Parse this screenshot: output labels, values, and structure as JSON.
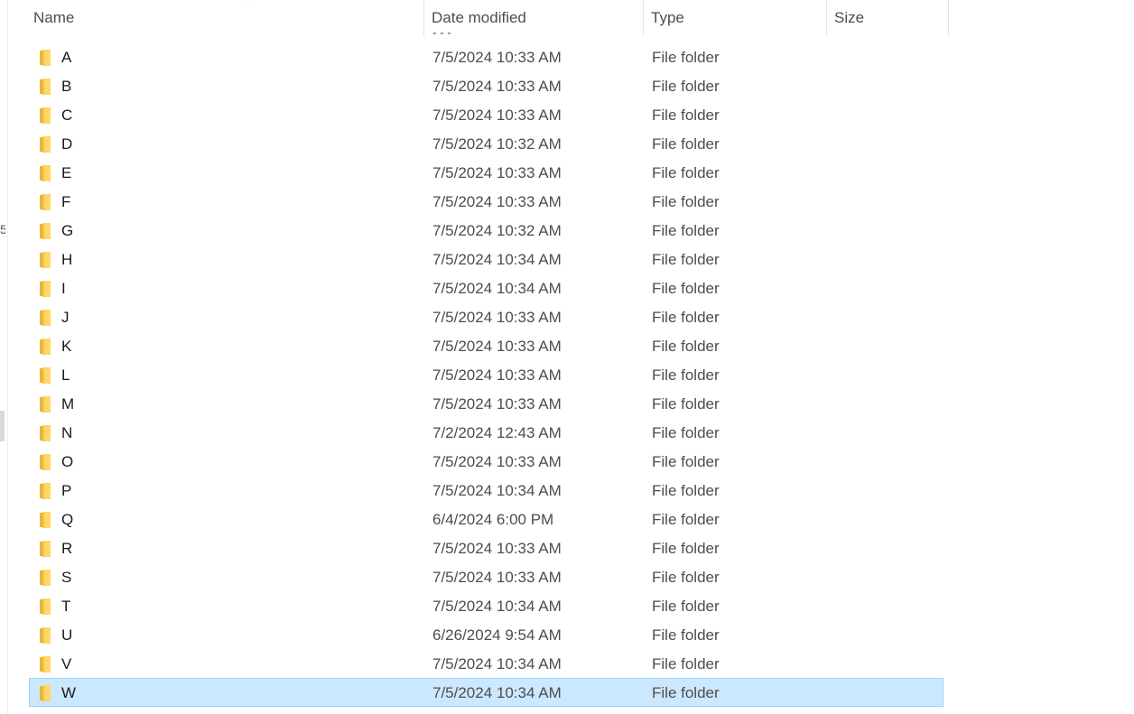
{
  "columns": {
    "name": "Name",
    "date_modified": "Date modified",
    "type": "Type",
    "size": "Size"
  },
  "sort_indicator": "chevron-up-icon",
  "nav_fragments": [
    "5"
  ],
  "files": [
    {
      "name": "A",
      "date": "7/5/2024 10:33 AM",
      "type": "File folder",
      "size": ""
    },
    {
      "name": "B",
      "date": "7/5/2024 10:33 AM",
      "type": "File folder",
      "size": ""
    },
    {
      "name": "C",
      "date": "7/5/2024 10:33 AM",
      "type": "File folder",
      "size": ""
    },
    {
      "name": "D",
      "date": "7/5/2024 10:32 AM",
      "type": "File folder",
      "size": ""
    },
    {
      "name": "E",
      "date": "7/5/2024 10:33 AM",
      "type": "File folder",
      "size": ""
    },
    {
      "name": "F",
      "date": "7/5/2024 10:33 AM",
      "type": "File folder",
      "size": ""
    },
    {
      "name": "G",
      "date": "7/5/2024 10:32 AM",
      "type": "File folder",
      "size": ""
    },
    {
      "name": "H",
      "date": "7/5/2024 10:34 AM",
      "type": "File folder",
      "size": ""
    },
    {
      "name": "I",
      "date": "7/5/2024 10:34 AM",
      "type": "File folder",
      "size": ""
    },
    {
      "name": "J",
      "date": "7/5/2024 10:33 AM",
      "type": "File folder",
      "size": ""
    },
    {
      "name": "K",
      "date": "7/5/2024 10:33 AM",
      "type": "File folder",
      "size": ""
    },
    {
      "name": "L",
      "date": "7/5/2024 10:33 AM",
      "type": "File folder",
      "size": ""
    },
    {
      "name": "M",
      "date": "7/5/2024 10:33 AM",
      "type": "File folder",
      "size": ""
    },
    {
      "name": "N",
      "date": "7/2/2024 12:43 AM",
      "type": "File folder",
      "size": ""
    },
    {
      "name": "O",
      "date": "7/5/2024 10:33 AM",
      "type": "File folder",
      "size": ""
    },
    {
      "name": "P",
      "date": "7/5/2024 10:34 AM",
      "type": "File folder",
      "size": ""
    },
    {
      "name": "Q",
      "date": "6/4/2024 6:00 PM",
      "type": "File folder",
      "size": ""
    },
    {
      "name": "R",
      "date": "7/5/2024 10:33 AM",
      "type": "File folder",
      "size": ""
    },
    {
      "name": "S",
      "date": "7/5/2024 10:33 AM",
      "type": "File folder",
      "size": ""
    },
    {
      "name": "T",
      "date": "7/5/2024 10:34 AM",
      "type": "File folder",
      "size": ""
    },
    {
      "name": "U",
      "date": "6/26/2024 9:54 AM",
      "type": "File folder",
      "size": ""
    },
    {
      "name": "V",
      "date": "7/5/2024 10:34 AM",
      "type": "File folder",
      "size": ""
    },
    {
      "name": "W",
      "date": "7/5/2024 10:34 AM",
      "type": "File folder",
      "size": "",
      "selected": true
    }
  ],
  "colors": {
    "selection_bg": "#cce8ff",
    "selection_border": "#99d1ff",
    "folder_front": "#ffd766",
    "folder_back": "#e8b53b"
  }
}
